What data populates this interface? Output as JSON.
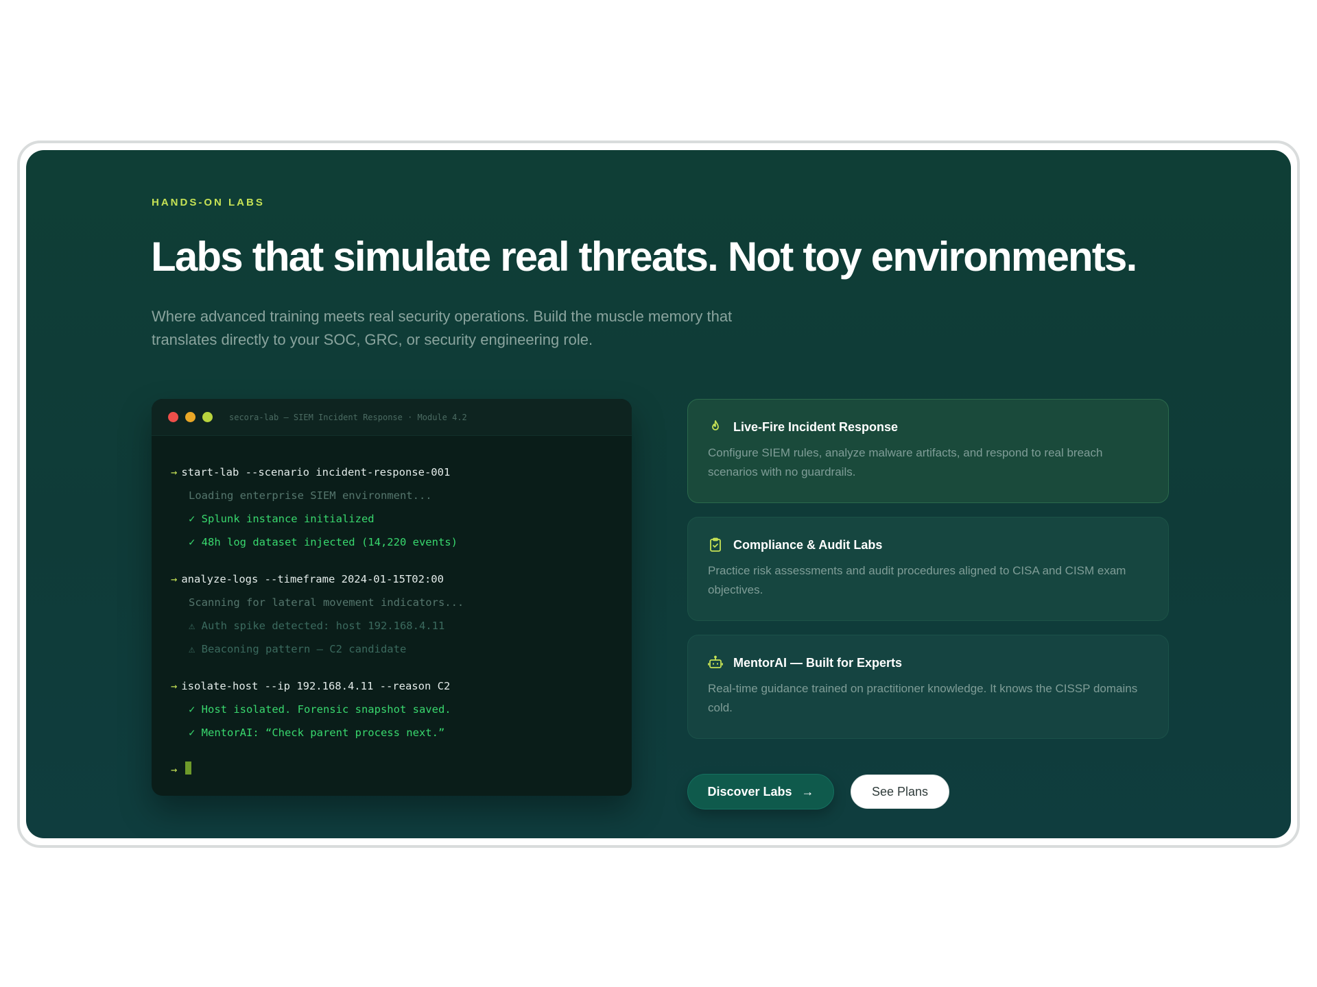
{
  "section": {
    "eyebrow": "HANDS-ON LABS",
    "headline": "Labs that simulate real threats. Not toy environments.",
    "subhead": "Where advanced training meets real security operations. Build the muscle memory that translates directly to your SOC, GRC, or security engineering role."
  },
  "terminal": {
    "title": "secora-lab — SIEM Incident Response · Module 4.2",
    "window_dots": [
      "#ee4f4a",
      "#e9a727",
      "#b8d43e"
    ],
    "prompt_symbol": "→",
    "blocks": [
      {
        "command": "start-lab --scenario incident-response-001",
        "output": [
          {
            "type": "info",
            "text": "Loading enterprise SIEM environment..."
          },
          {
            "type": "ok",
            "text": "✓ Splunk instance initialized"
          },
          {
            "type": "ok",
            "text": "✓ 48h log dataset injected (14,220 events)"
          }
        ]
      },
      {
        "command": "analyze-logs --timeframe 2024-01-15T02:00",
        "output": [
          {
            "type": "info",
            "text": "Scanning for lateral movement indicators..."
          },
          {
            "type": "warn",
            "text": "⚠ Auth spike detected: host 192.168.4.11"
          },
          {
            "type": "warn",
            "text": "⚠ Beaconing pattern — C2 candidate"
          }
        ]
      },
      {
        "command": "isolate-host --ip 192.168.4.11 --reason C2",
        "output": [
          {
            "type": "ok",
            "text": "✓ Host isolated. Forensic snapshot saved."
          },
          {
            "type": "ok",
            "text": "✓ MentorAI: “Check parent process next.”"
          }
        ]
      }
    ]
  },
  "cards": [
    {
      "icon": "flame-icon",
      "title": "Live-Fire Incident Response",
      "description": "Configure SIEM rules, analyze malware artifacts, and respond to real breach scenarios with no guardrails."
    },
    {
      "icon": "clipboard-check-icon",
      "title": "Compliance & Audit Labs",
      "description": "Practice risk assessments and audit procedures aligned to CISA and CISM exam objectives."
    },
    {
      "icon": "robot-icon",
      "title": "MentorAI — Built for Experts",
      "description": "Real-time guidance trained on practitioner knowledge. It knows the CISSP domains cold."
    }
  ],
  "actions": {
    "primary_label": "Discover Labs",
    "primary_arrow": "→",
    "secondary_label": "See Plans"
  },
  "colors": {
    "accent": "#c6e255",
    "panel": "#0f3e36",
    "success": "#39d86e"
  }
}
